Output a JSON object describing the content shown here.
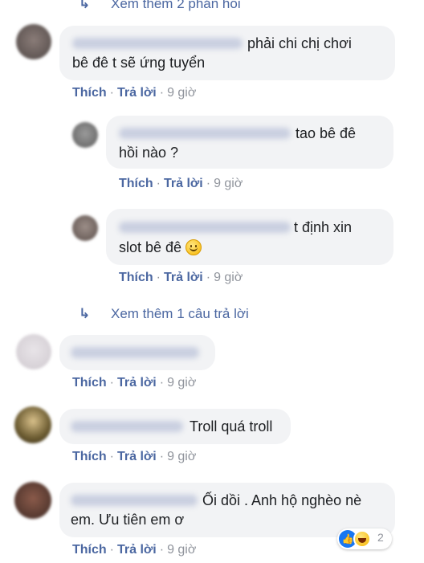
{
  "top_more": {
    "label": "Xem thêm 2 phản hồi"
  },
  "comments": [
    {
      "text_1": "phải chi chị chơi",
      "text_2": "bê đê t sẽ ứng tuyển",
      "like": "Thích",
      "reply": "Trả lời",
      "time": "9 giờ"
    },
    {
      "text_1": "tao bê đê",
      "text_2": "hồi nào ?",
      "like": "Thích",
      "reply": "Trả lời",
      "time": "9 giờ"
    },
    {
      "text_1": "t định xin",
      "text_2": "slot bê đê",
      "like": "Thích",
      "reply": "Trả lời",
      "time": "9 giờ",
      "emoji": "smiling-face"
    },
    {
      "text_1": "",
      "like": "Thích",
      "reply": "Trả lời",
      "time": "9 giờ"
    },
    {
      "text_1": "Troll quá troll",
      "like": "Thích",
      "reply": "Trả lời",
      "time": "9 giờ"
    },
    {
      "text_1": "Ối dồi . Anh hộ nghèo nè",
      "text_2": "em. Ưu tiên em ơ",
      "like": "Thích",
      "reply": "Trả lời",
      "time": "9 giờ",
      "reaction_count": "2"
    }
  ],
  "more_replies": {
    "label": "Xem thêm 1 câu trả lời"
  },
  "colors": {
    "link": "#4b67a1",
    "bubble": "#f2f3f5",
    "meta": "#90949c",
    "like_blue": "#1877f2"
  }
}
